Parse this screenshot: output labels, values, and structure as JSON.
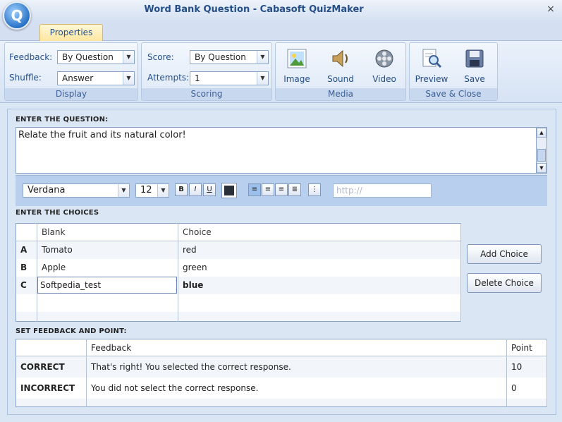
{
  "window": {
    "title": "Word Bank Question - Cabasoft QuizMaker",
    "close_glyph": "×",
    "orb_letter": "Q"
  },
  "ribbon": {
    "tab": "Properties",
    "display": {
      "feedback_label": "Feedback:",
      "feedback_value": "By Question",
      "shuffle_label": "Shuffle:",
      "shuffle_value": "Answer",
      "group_label": "Display"
    },
    "scoring": {
      "score_label": "Score:",
      "score_value": "By Question",
      "attempts_label": "Attempts:",
      "attempts_value": "1",
      "group_label": "Scoring"
    },
    "media": {
      "image": "Image",
      "sound": "Sound",
      "video": "Video",
      "group_label": "Media"
    },
    "save_close": {
      "preview": "Preview",
      "save": "Save",
      "group_label": "Save & Close"
    }
  },
  "question": {
    "section_title": "ENTER THE QUESTION:",
    "text": "Relate the fruit and its natural color!",
    "font": "Verdana",
    "size": "12",
    "bold": "B",
    "italic": "I",
    "underline": "U",
    "url_placeholder": "http://"
  },
  "choices": {
    "section_title": "ENTER THE CHOICES",
    "headers": [
      "Blank",
      "Choice"
    ],
    "rows": [
      {
        "letter": "A",
        "blank": "Tomato",
        "choice": "red"
      },
      {
        "letter": "B",
        "blank": "Apple",
        "choice": "green"
      },
      {
        "letter": "C",
        "blank": "Softpedia_test",
        "choice": "blue"
      }
    ],
    "add_button": "Add Choice",
    "delete_button": "Delete Choice"
  },
  "feedback": {
    "section_title": "SET FEEDBACK AND POINT:",
    "headers": [
      "Feedback",
      "Point"
    ],
    "rows": [
      {
        "kind": "CORRECT",
        "text": "That's right!  You selected the correct response.",
        "point": "10"
      },
      {
        "kind": "INCORRECT",
        "text": "You did not select the correct response.",
        "point": "0"
      }
    ]
  },
  "colors": {
    "accent": "#244f8a",
    "ribbon_bg": "#d6e3f4",
    "toolbar_bg": "#b8d0ee"
  }
}
